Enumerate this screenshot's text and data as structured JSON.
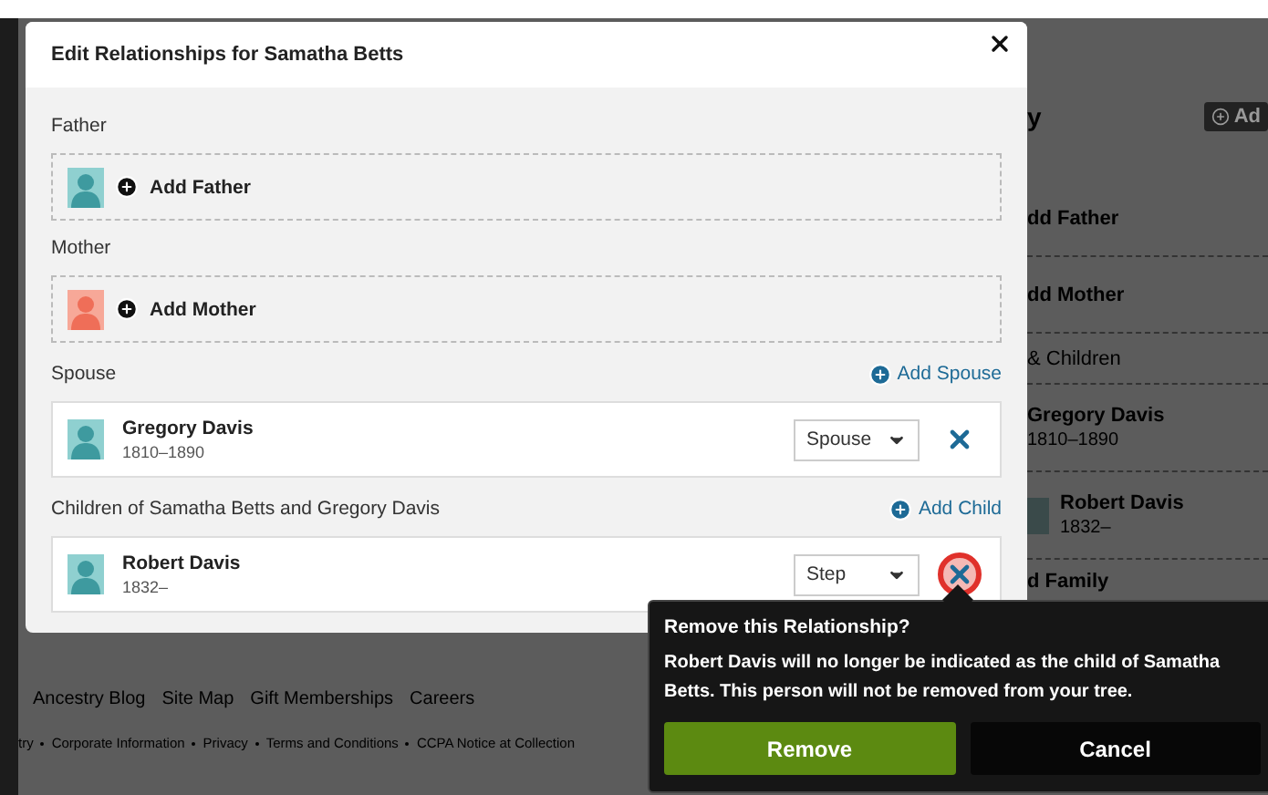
{
  "dialog": {
    "title": "Edit Relationships for Samatha Betts",
    "parents": [
      {
        "label": "Father",
        "action": "Add Father",
        "kind": "male"
      },
      {
        "label": "Mother",
        "action": "Add Mother",
        "kind": "female"
      }
    ],
    "sections": [
      {
        "label": "Spouse",
        "action": "Add Spouse",
        "people": [
          {
            "name": "Gregory Davis",
            "years": "1810–1890",
            "relation": "Spouse",
            "highlighted": false
          }
        ]
      },
      {
        "label": "Children of Samatha Betts and Gregory Davis",
        "action": "Add Child",
        "people": [
          {
            "name": "Robert Davis",
            "years": "1832–",
            "relation": "Step",
            "highlighted": true
          }
        ]
      }
    ]
  },
  "popover": {
    "title": "Remove this Relationship?",
    "message": "Robert Davis will no longer be indicated as the child of Samatha Betts. This person will not be removed from your tree.",
    "confirm": "Remove",
    "cancel": "Cancel"
  },
  "background": {
    "title": "y",
    "add_button": "Ad",
    "rows": [
      {
        "kind": "add",
        "text": "dd Father"
      },
      {
        "kind": "add",
        "text": "dd Mother"
      },
      {
        "kind": "section",
        "text": "& Children"
      },
      {
        "kind": "person",
        "text": "Gregory Davis",
        "years": "1810–1890"
      },
      {
        "kind": "person",
        "text": "Robert Davis",
        "years": "1832–"
      },
      {
        "kind": "add",
        "text": "d Family"
      }
    ],
    "footer_links": [
      "Ancestry Blog",
      "Site Map",
      "Gift Memberships",
      "Careers"
    ],
    "legal": [
      "try",
      "Corporate Information",
      "Privacy",
      "Terms and Conditions",
      "CCPA Notice at Collection"
    ]
  }
}
